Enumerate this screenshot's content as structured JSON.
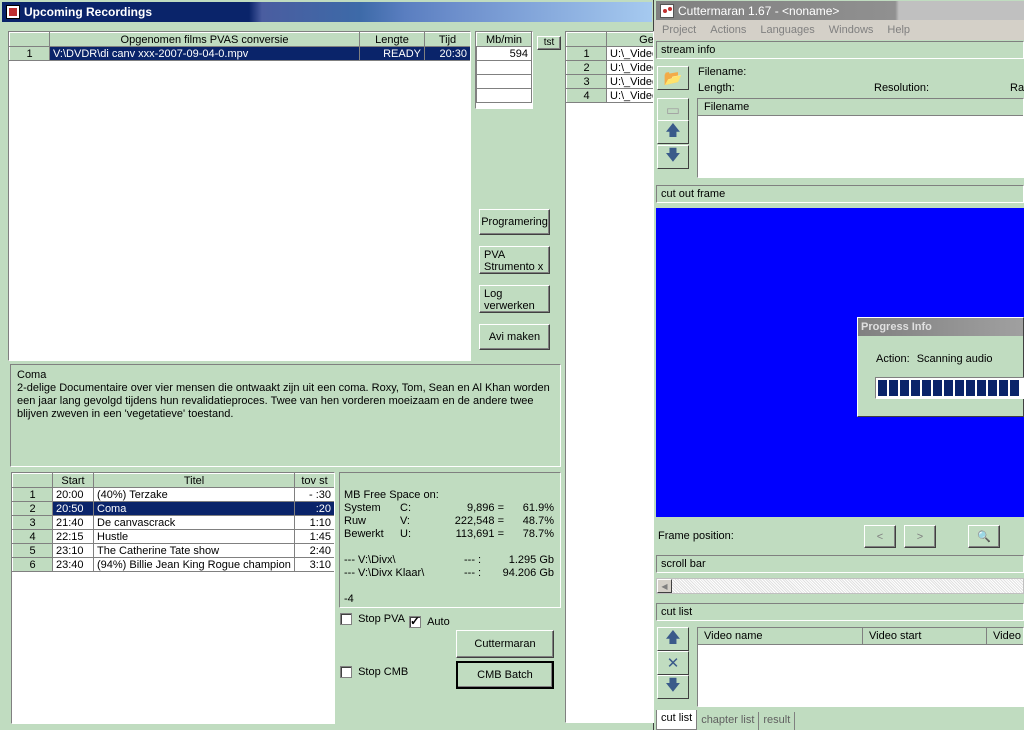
{
  "left_window": {
    "title": "Upcoming Recordings",
    "recordings_table": {
      "headers": [
        "",
        "Opgenomen films PVAS conversie",
        "Lengte",
        "Tijd"
      ],
      "rows": [
        [
          "1",
          "V:\\DVDR\\di canv xxx-2007-09-04-0.mpv",
          "READY",
          "20:30"
        ]
      ]
    },
    "mbmin": {
      "header": "Mb/min",
      "value": "594"
    },
    "tst_label": "tst",
    "files_table": {
      "header": "Gekr",
      "rows": [
        [
          "1",
          "U:\\_Video"
        ],
        [
          "2",
          "U:\\_Video"
        ],
        [
          "3",
          "U:\\_Video"
        ],
        [
          "4",
          "U:\\_Video"
        ]
      ]
    },
    "buttons": {
      "programering": "Programering",
      "pva_strumento": "PVA Strumento x",
      "log_verwerken": "Log verwerken",
      "avi_maken": "Avi maken",
      "cuttermaran": "Cuttermaran",
      "cmb_batch": "CMB Batch"
    },
    "description": {
      "title": "Coma",
      "text": "2-delige Documentaire over vier mensen die ontwaakt zijn uit een coma. Roxy, Tom, Sean en Al Khan worden een jaar lang gevolgd tijdens hun revalidatieproces. Twee van hen vorderen moeizaam en de andere twee blijven zweven in een 'vegetatieve' toestand."
    },
    "schedule": {
      "headers": [
        "",
        "Start",
        "Titel",
        "tov st"
      ],
      "rows": [
        [
          "1",
          "20:00",
          "(40%) Terzake",
          "- :30"
        ],
        [
          "2",
          "20:50",
          "Coma",
          ":20"
        ],
        [
          "3",
          "21:40",
          "De canvascrack",
          "1:10"
        ],
        [
          "4",
          "22:15",
          "Hustle",
          "1:45"
        ],
        [
          "5",
          "23:10",
          "The Catherine Tate show",
          "2:40"
        ],
        [
          "6",
          "23:40",
          "(94%) Billie Jean King Rogue champion",
          "3:10"
        ]
      ],
      "selected_index": 1
    },
    "free_space": {
      "heading": "MB Free Space on:",
      "rows": [
        [
          "System",
          "C:",
          "9,896 =",
          "61.9%"
        ],
        [
          "Ruw",
          "V:",
          "222,548 =",
          "48.7%"
        ],
        [
          "Bewerkt",
          "U:",
          "113,691 =",
          "78.7%"
        ]
      ],
      "dirs": [
        [
          "--- V:\\Divx\\",
          "--- :",
          "1.295 Gb"
        ],
        [
          "--- V:\\Divx Klaar\\",
          "--- :",
          "94.206 Gb"
        ]
      ],
      "footer": "-4"
    },
    "checkboxes": {
      "stop_pva": "Stop PVA",
      "auto": "Auto",
      "stop_cmb": "Stop CMB",
      "auto_checked": true
    }
  },
  "cuttermaran": {
    "title": "Cuttermaran 1.67 - <noname>",
    "menu": [
      "Project",
      "Actions",
      "Languages",
      "Windows",
      "Help"
    ],
    "stream_info": "stream info",
    "filename_label": "Filename:",
    "length_label": "Length:",
    "resolution_label": "Resolution:",
    "ra_label": "Ra",
    "file_list_header": "Filename",
    "cut_out_frame": "cut out frame",
    "frame_position": "Frame position:",
    "scroll_bar": "scroll bar",
    "cut_list": "cut list",
    "cut_columns": [
      "Video name",
      "Video start",
      "Video"
    ],
    "tabs": [
      "cut list",
      "chapter list",
      "result"
    ],
    "progress": {
      "title": "Progress Info",
      "action_label": "Action:",
      "action_value": "Scanning audio",
      "blocks": 13
    }
  }
}
